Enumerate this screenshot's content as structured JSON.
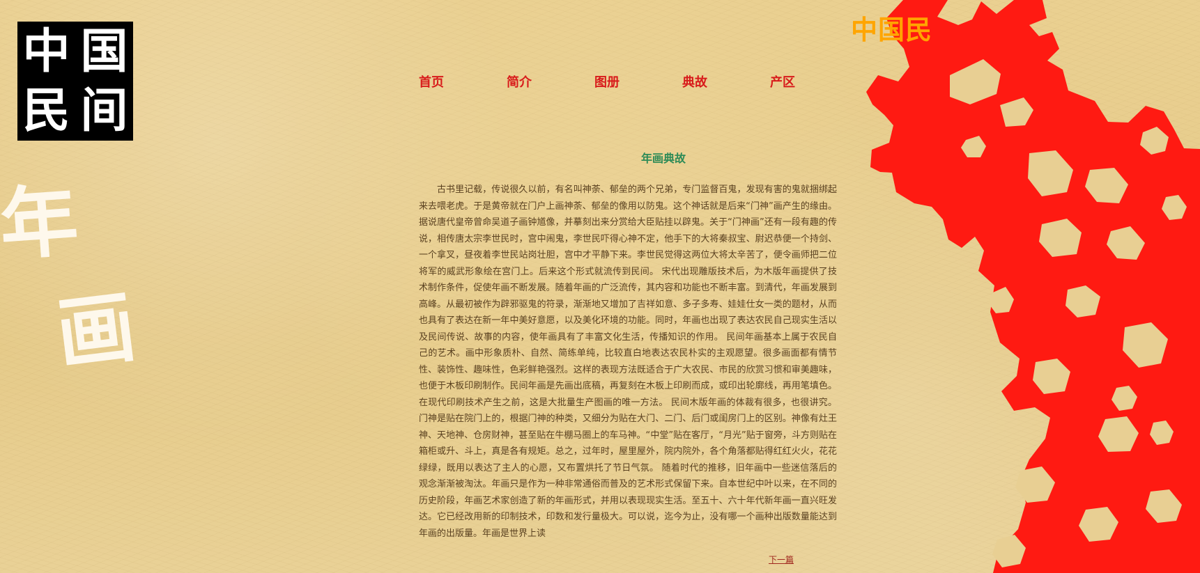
{
  "logo": {
    "chars": [
      "中",
      "国",
      "民",
      "间"
    ]
  },
  "left_art": {
    "line1": "年",
    "line2": "画"
  },
  "header": {
    "top_right_title": "中国民"
  },
  "nav": {
    "items": [
      "首页",
      "简介",
      "图册",
      "典故",
      "产区"
    ]
  },
  "main": {
    "title": "年画典故",
    "body": "古书里记载，传说很久以前，有名叫神荼、郁垒的两个兄弟，专门监督百鬼，发现有害的鬼就捆绑起来去喂老虎。于是黄帝就在门户上画神荼、郁垒的像用以防鬼。这个神话就是后来“门神”画产生的缘由。据说唐代皇帝曾命吴道子画钟馗像，并摹刻出来分赏给大臣贴挂以辟鬼。关于“门神画”还有一段有趣的传说，相传唐太宗李世民时，宫中闹鬼，李世民吓得心神不定，他手下的大将秦叔宝、尉迟恭便一个持剑、一个拿叉，昼夜着李世民站岗壮胆，宫中才平静下来。李世民觉得这两位大将太辛苦了，便令画师把二位将军的威武形象绘在宫门上。后来这个形式就流传到民间。 宋代出现雕版技术后，为木版年画提供了技术制作条件，促使年画不断发展。随着年画的广泛流传，其内容和功能也不断丰富。到清代，年画发展到高峰。从最初被作为辟邪驱鬼的符录，渐渐地又增加了吉祥如意、多子多寿、娃娃仕女一类的题材，从而也具有了表达在新一年中美好意愿，以及美化环境的功能。同时，年画也出现了表达农民自己现实生活以及民间传说、故事的内容，使年画具有了丰富文化生活，传播知识的作用。 民间年画基本上属于农民自己的艺术。画中形象质朴、自然、简练单纯，比较直白地表达农民朴实的主观愿望。很多画面都有情节性、装饰性、趣味性，色彩鲜艳强烈。这样的表现方法既适合于广大农民、市民的欣赏习惯和审美趣味，也便于木板印刷制作。民间年画是先画出底稿，再复刻在木板上印刷而成，或印出轮廓线，再用笔填色。在现代印刷技术产生之前，这是大批量生产图画的唯一方法。 民间木版年画的体裁有很多，也很讲究。门神是贴在院门上的，根据门神的种类，又细分为贴在大门、二门、后门或闺房门上的区别。神像有灶王神、天地神、仓房财神，甚至贴在牛棚马圈上的车马神。“中堂”贴在客厅，“月光”贴于窗旁，斗方则贴在箱柜或升、斗上，真是各有规矩。总之，过年时，屋里屋外，院内院外，各个角落都贴得红红火火，花花绿绿，既用以表达了主人的心愿，又布置烘托了节日气氛。 随着时代的推移，旧年画中一些迷信落后的观念渐渐被淘汰。年画只是作为一种非常通俗而普及的艺术形式保留下来。自本世纪中叶以来，在不同的历史阶段，年画艺术家创造了新的年画形式，并用以表现现实生活。至五十、六十年代新年画一直兴旺发达。它已经改用新的印制技术，印数和发行量极大。可以说，迄今为止，没有哪一个画种出版数量能达到年画的出版量。年画是世界上读",
    "next_link": "下一篇"
  },
  "colors": {
    "nav_red": "#d81b1b",
    "title_green": "#2e8b57",
    "orange_title": "#ffa500",
    "papercut_red": "#ff1a12"
  },
  "icons": {
    "decorative_papercut": "red-papercut-figure"
  }
}
